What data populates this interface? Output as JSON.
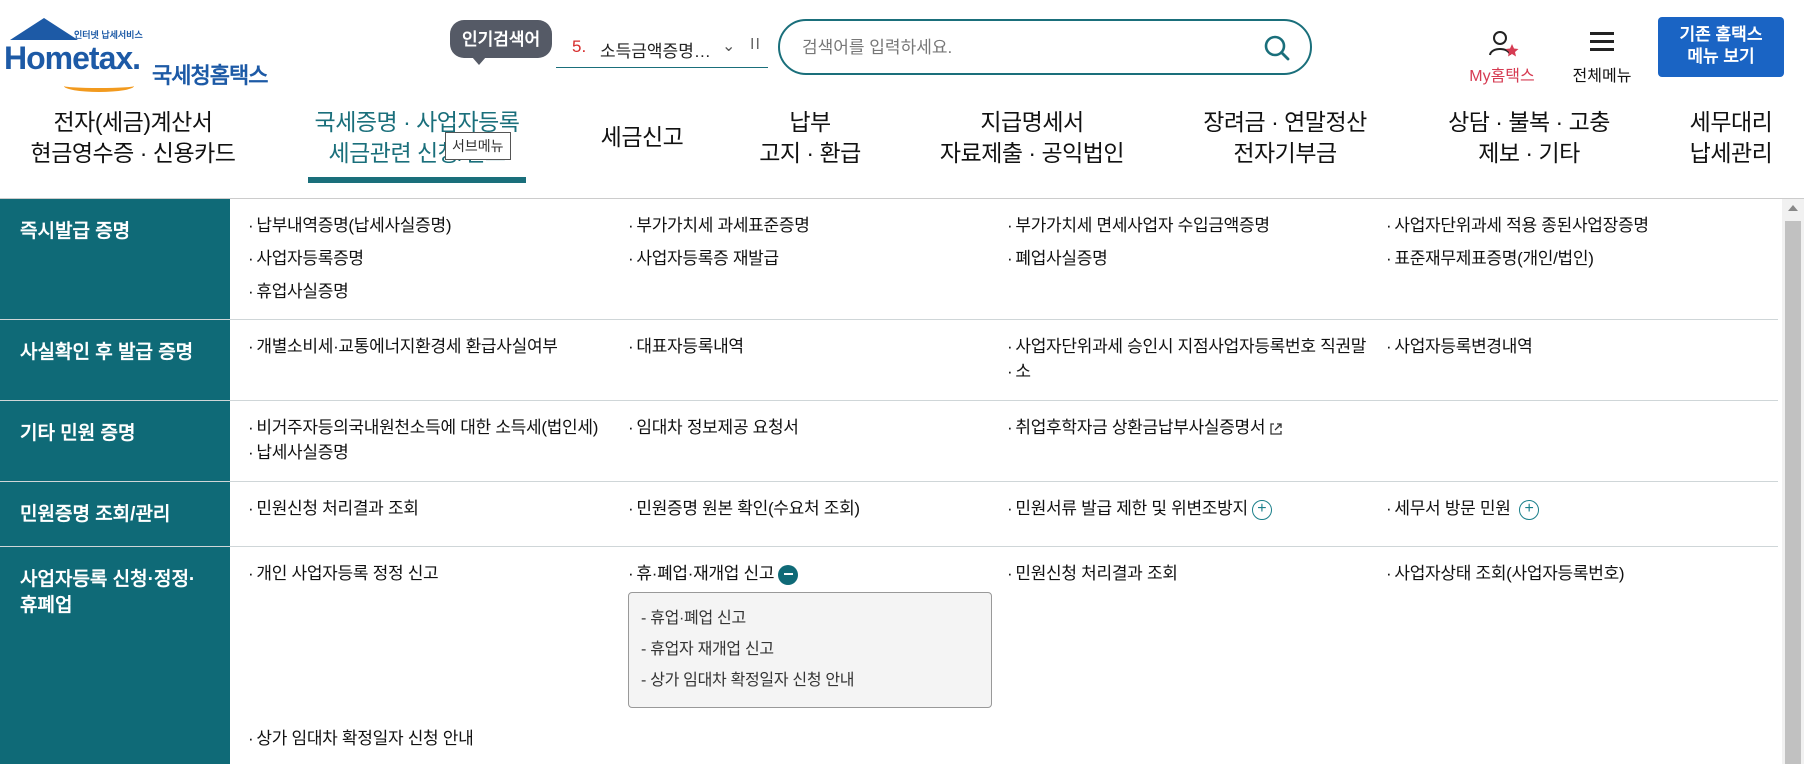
{
  "logo": {
    "word": "Hometax.",
    "small": "인터넷 납세서비스",
    "kr": "국세청홈택스"
  },
  "popular": {
    "badge": "인기검색어",
    "rank": "5.",
    "text": "소득금액증명…",
    "chevron": "⌄",
    "pause": "II"
  },
  "search": {
    "placeholder": "검색어를 입력하세요."
  },
  "utility": {
    "myhome": "My홈택스",
    "fullmenu": "전체메뉴",
    "legacy_line1": "기존 홈택스",
    "legacy_line2": "메뉴 보기"
  },
  "nav": [
    {
      "line1": "전자(세금)계산서",
      "line2": "현금영수증 · 신용카드"
    },
    {
      "line1": "국세증명 · 사업자등록",
      "line2": "세금관련 신청/신고"
    },
    {
      "line1": "세금신고",
      "line2": ""
    },
    {
      "line1": "납부",
      "line2": "고지 · 환급"
    },
    {
      "line1": "지급명세서",
      "line2": "자료제출 · 공익법인"
    },
    {
      "line1": "장려금 · 연말정산",
      "line2": "전자기부금"
    },
    {
      "line1": "상담 · 불복 · 고충",
      "line2": "제보 · 기타"
    },
    {
      "line1": "세무대리",
      "line2": "납세관리"
    }
  ],
  "tooltip": "서브메뉴",
  "rows": [
    {
      "title": "즉시발급 증명",
      "links": [
        "납부내역증명(납세사실증명)",
        "부가가치세 과세표준증명",
        "부가가치세 면세사업자 수입금액증명",
        "사업자단위과세 적용 종된사업장증명",
        "사업자등록증명",
        "사업자등록증 재발급",
        "폐업사실증명",
        "표준재무제표증명(개인/법인)",
        "휴업사실증명"
      ]
    },
    {
      "title": "사실확인 후 발급 증명",
      "links": [
        "개별소비세·교통에너지환경세 환급사실여부",
        "대표자등록내역",
        "사업자단위과세 승인시 지점사업자등록번호 직권말",
        "소",
        "사업자등록변경내역"
      ]
    },
    {
      "title": "기타 민원 증명",
      "links": [
        "비거주자등의국내원천소득에 대한 소득세(법인세)",
        "납세사실증명",
        "임대차 정보제공 요청서",
        "취업후학자금 상환금납부사실증명서"
      ]
    },
    {
      "title": "민원증명 조회/관리",
      "links": [
        "민원신청 처리결과 조회",
        "민원증명 원본 확인(수요처 조회)",
        "민원서류 발급 제한 및 위변조방지",
        "세무서 방문 민원"
      ]
    },
    {
      "title_line1": "사업자등록 신청·정정·",
      "title_line2": "휴폐업",
      "links": [
        "개인 사업자등록 정정 신고",
        "휴·폐업·재개업 신고",
        "민원신청 처리결과 조회",
        "사업자상태 조회(사업자등록번호)",
        "상가 임대차 확정일자 신청 안내"
      ],
      "sublinks": [
        "휴업·폐업 신고",
        "휴업자 재개업 신고",
        "상가 임대차 확정일자 신청 안내"
      ]
    }
  ],
  "colors": {
    "teal": "#0f6a77",
    "brand_blue": "#1d5aa6",
    "button_blue": "#1a64c4",
    "accent_red": "#d63b52"
  }
}
